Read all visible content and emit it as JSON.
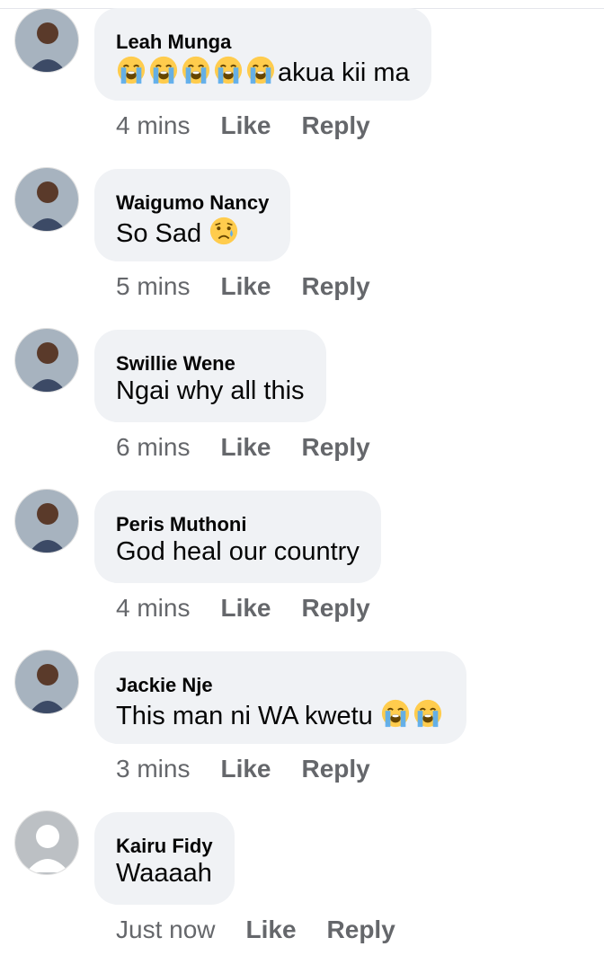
{
  "comments": [
    {
      "author": "Leah Munga",
      "emoji_before": 5,
      "emoji_before_icon": "loudly-crying-face-icon",
      "text": "akua kii ma",
      "emoji_after": 0,
      "emoji_after_icon": "",
      "time": "4 mins",
      "like": "Like",
      "reply": "Reply",
      "avatar": "photo"
    },
    {
      "author": "Waigumo Nancy",
      "emoji_before": 0,
      "emoji_before_icon": "",
      "text": "So Sad ",
      "emoji_after": 1,
      "emoji_after_icon": "sad-but-relieved-face-icon",
      "time": "5 mins",
      "like": "Like",
      "reply": "Reply",
      "avatar": "photo"
    },
    {
      "author": "Swillie Wene",
      "emoji_before": 0,
      "emoji_before_icon": "",
      "text": "Ngai why all this",
      "emoji_after": 0,
      "emoji_after_icon": "",
      "time": "6 mins",
      "like": "Like",
      "reply": "Reply",
      "avatar": "photo"
    },
    {
      "author": "Peris Muthoni",
      "emoji_before": 0,
      "emoji_before_icon": "",
      "text": "God heal our country",
      "emoji_after": 0,
      "emoji_after_icon": "",
      "time": "4 mins",
      "like": "Like",
      "reply": "Reply",
      "avatar": "photo"
    },
    {
      "author": "Jackie Nje",
      "emoji_before": 0,
      "emoji_before_icon": "",
      "text": "This man ni WA kwetu ",
      "emoji_after": 2,
      "emoji_after_icon": "loudly-crying-face-icon",
      "time": "3 mins",
      "like": "Like",
      "reply": "Reply",
      "avatar": "photo"
    },
    {
      "author": "Kairu Fidy",
      "emoji_before": 0,
      "emoji_before_icon": "",
      "text": "Waaaah",
      "emoji_after": 0,
      "emoji_after_icon": "",
      "time": "Just now",
      "like": "Like",
      "reply": "Reply",
      "avatar": "default-profile-placeholder"
    }
  ],
  "colors": {
    "bubble": "#f0f2f5",
    "meta_text": "#65676b",
    "author_text": "#050505",
    "placeholder_avatar": "#bcc0c4"
  }
}
